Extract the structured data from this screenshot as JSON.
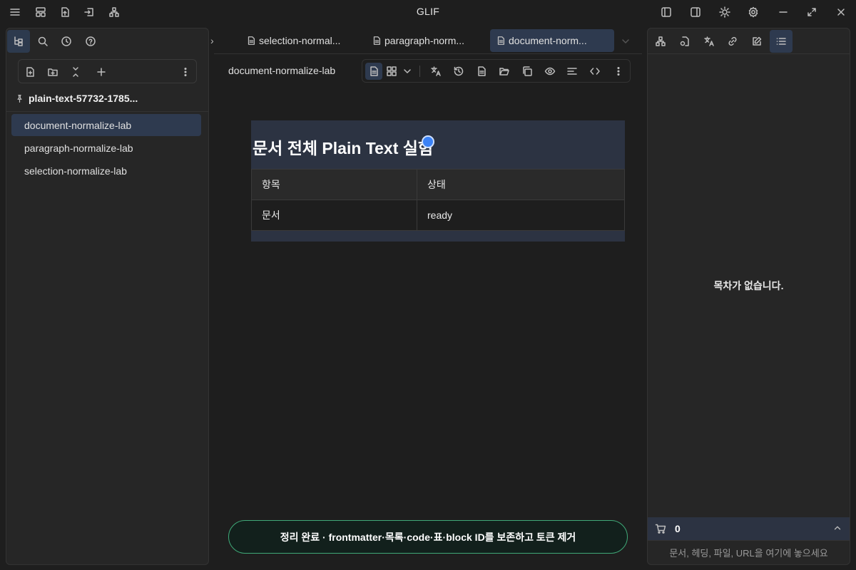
{
  "window": {
    "title": "GLIF"
  },
  "left_panel": {
    "vault_name": "plain-text-57732-1785...",
    "files": [
      {
        "name": "document-normalize-lab",
        "active": true
      },
      {
        "name": "paragraph-normalize-lab",
        "active": false
      },
      {
        "name": "selection-normalize-lab",
        "active": false
      }
    ]
  },
  "tabs": [
    {
      "label": "selection-normal...",
      "active": false
    },
    {
      "label": "paragraph-norm...",
      "active": false
    },
    {
      "label": "document-norm...",
      "active": true
    }
  ],
  "editor": {
    "doc_title": "document-normalize-lab",
    "heading": "문서 전체 Plain Text 실험",
    "table": {
      "headers": [
        "항목",
        "상태"
      ],
      "rows": [
        [
          "문서",
          "ready"
        ]
      ]
    }
  },
  "toast": {
    "message": "정리 완료 · frontmatter·목록·code·표·block ID를 보존하고 토큰 제거"
  },
  "right_panel": {
    "toc_empty": "목차가 없습니다.",
    "cart_count": "0",
    "drop_placeholder": "문서, 헤딩, 파일, URL을 여기에 놓으세요"
  },
  "colors": {
    "accent_active": "#2e3a4f",
    "toast_border": "#3fa978",
    "cursor_dot": "#3b82f6"
  }
}
